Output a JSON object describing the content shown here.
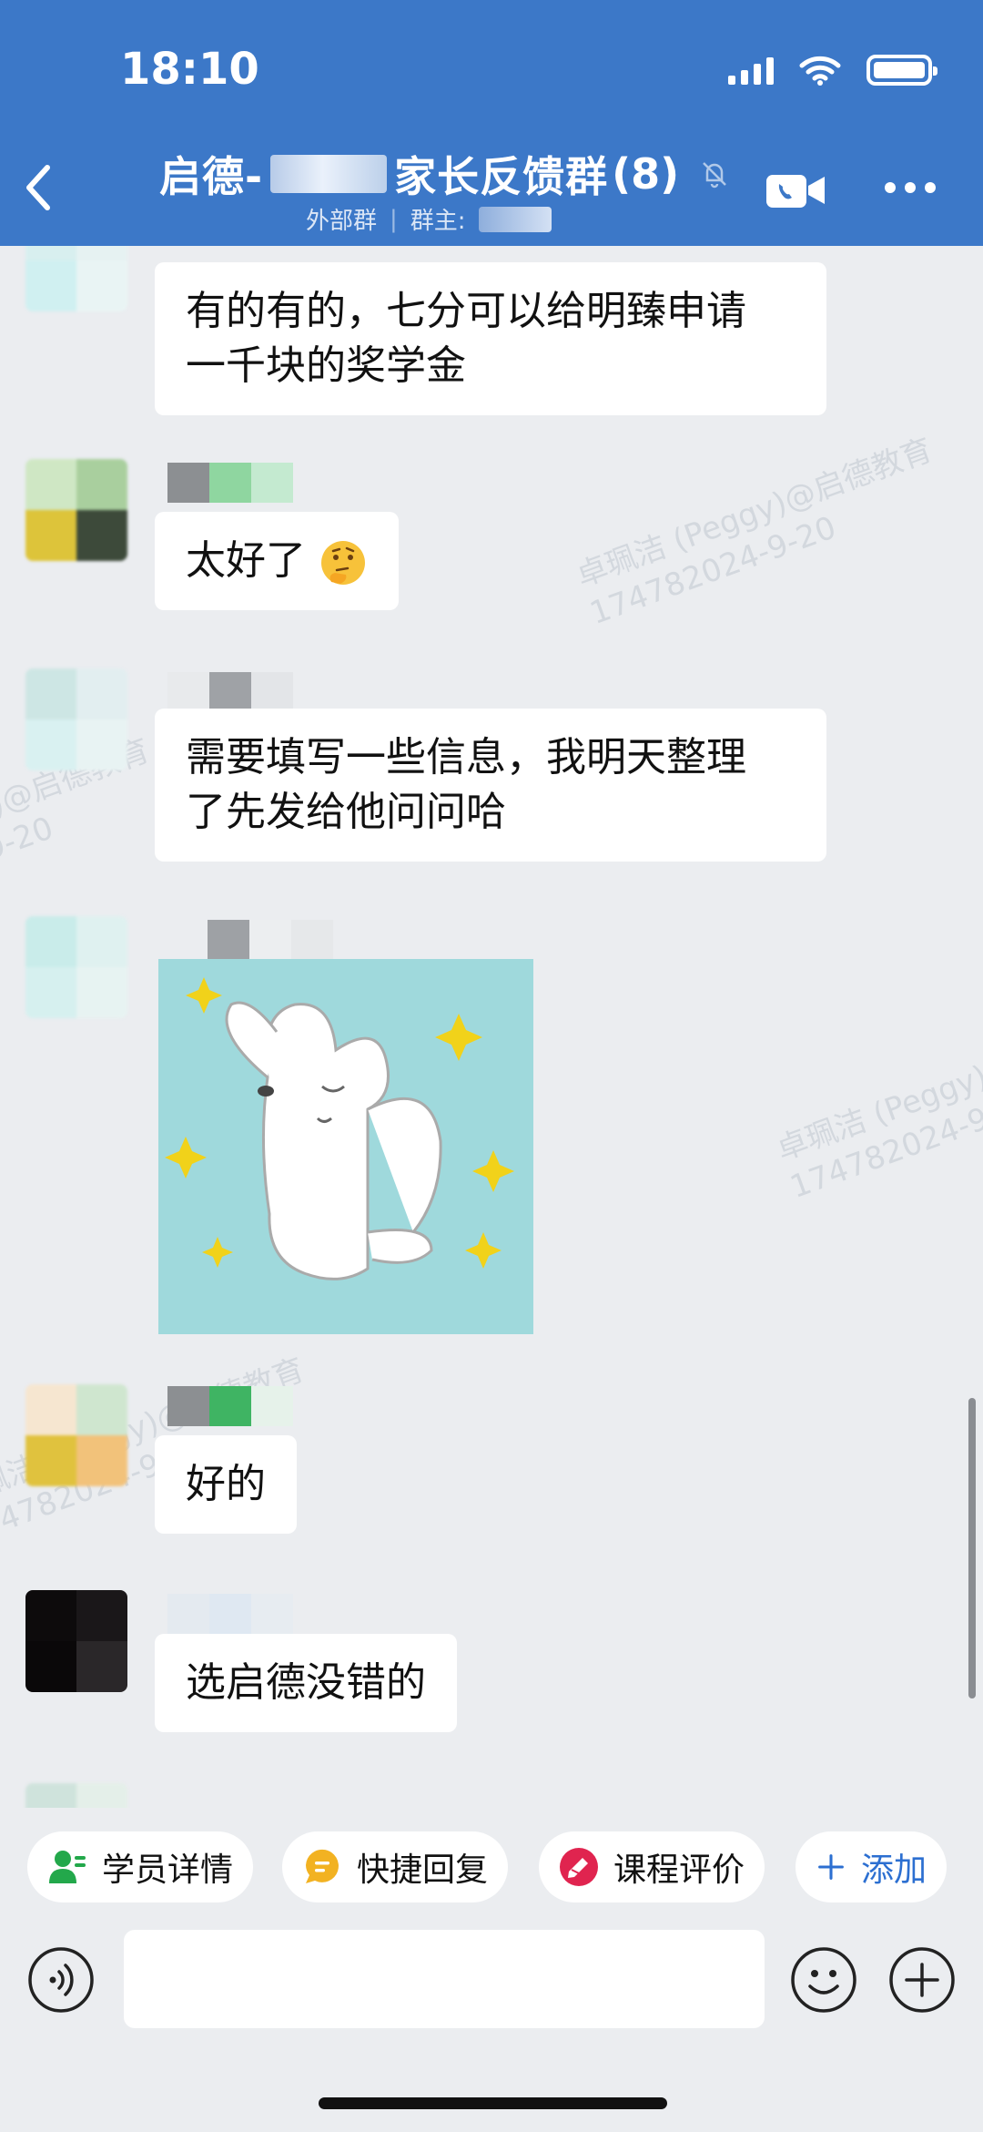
{
  "status_bar": {
    "time": "18:10"
  },
  "header": {
    "title_prefix": "启德-",
    "title_suffix": "家长反馈群",
    "member_count": "(8)",
    "subtitle_tag": "外部群",
    "subtitle_owner_label": "群主:"
  },
  "messages": [
    {
      "text_line1": "有的有的，七分可以给明臻申请",
      "text_line2": "一千块的奖学金"
    },
    {
      "text": "太好了"
    },
    {
      "text_line1": "需要填写一些信息，我明天整理",
      "text_line2": "了先发给他问问哈"
    },
    {
      "type": "sticker",
      "icon": "dancing-dog-sticker"
    },
    {
      "text": "好的"
    },
    {
      "text": "选启德没错的"
    }
  ],
  "watermark": {
    "line1": "卓珮洁 (Peggy)@启德教育",
    "line2": "174782024-9-20"
  },
  "toolbar": {
    "student_details": "学员详情",
    "quick_reply": "快捷回复",
    "course_review": "课程评价",
    "add": "添加"
  },
  "colors": {
    "header": "#3c78c8",
    "background": "#ebedf0",
    "accent": "#2c6fd1"
  }
}
